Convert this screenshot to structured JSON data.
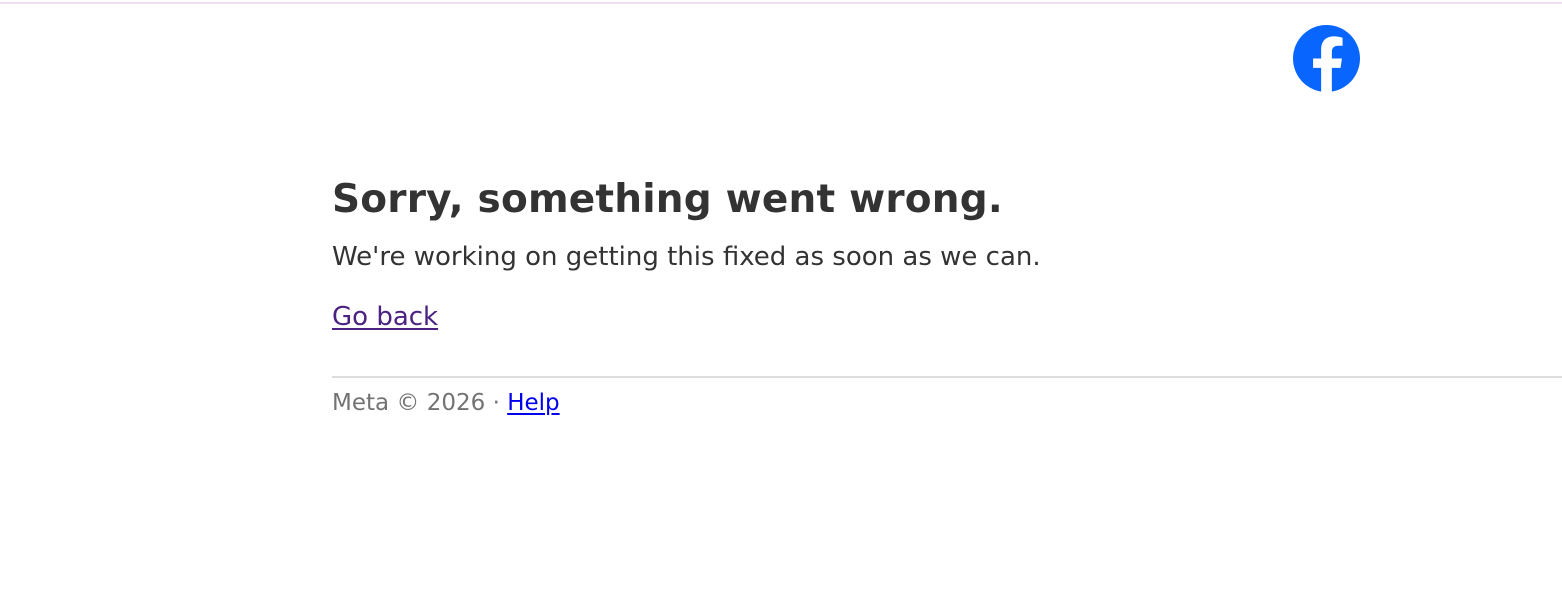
{
  "header": {
    "logo_icon": "facebook-logo-icon",
    "logo_color": "#0866ff"
  },
  "error": {
    "title": "Sorry, something went wrong.",
    "message": "We're working on getting this fixed as soon as we can.",
    "go_back_label": "Go back"
  },
  "footer": {
    "copyright": "Meta © 2026",
    "separator": "·",
    "help_label": "Help"
  },
  "colors": {
    "text": "#333333",
    "muted": "#737373",
    "visited_link": "#4b2282",
    "link": "#0000ee"
  }
}
